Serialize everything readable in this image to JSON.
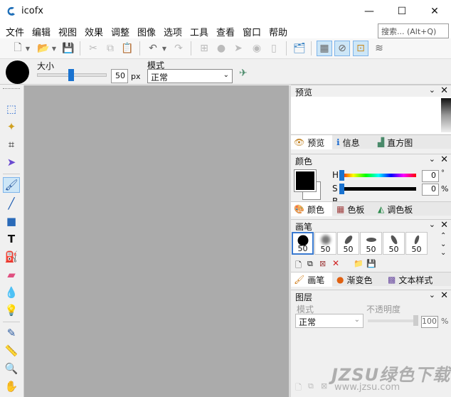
{
  "app": {
    "title": "icofx"
  },
  "window": {
    "minimize": "—",
    "maximize": "☐",
    "close": "✕"
  },
  "menu": [
    "文件",
    "编辑",
    "视图",
    "效果",
    "调整",
    "图像",
    "选项",
    "工具",
    "查看",
    "窗口",
    "帮助"
  ],
  "search": {
    "placeholder": "搜索... (Alt+Q)"
  },
  "options": {
    "size_label": "大小",
    "size_value": "50",
    "size_unit": "px",
    "mode_label": "模式",
    "mode_value": "正常"
  },
  "panels": {
    "preview": {
      "title": "预览",
      "tabs": [
        "预览",
        "信息",
        "直方图"
      ]
    },
    "color": {
      "title": "颜色",
      "h_label": "H",
      "h_value": "0",
      "h_unit": "°",
      "s_label": "S",
      "s_value": "0",
      "s_unit": "%",
      "b_label": "B",
      "tabs": [
        "颜色",
        "色板",
        "调色板"
      ]
    },
    "brush": {
      "title": "画笔",
      "sizes": [
        "50",
        "50",
        "50",
        "50",
        "50",
        "50"
      ],
      "tabs": [
        "画笔",
        "渐变色",
        "文本样式"
      ]
    },
    "layers": {
      "title": "图层",
      "mode_label": "模式",
      "opacity_label": "不透明度",
      "mode_value": "正常",
      "opacity_value": "100",
      "opacity_unit": "%"
    }
  },
  "watermark": {
    "line1": "JZSU绿色下载",
    "line2": "www.jzsu.com"
  },
  "colors": {
    "primary": "#000000",
    "selection": "#cde6f7",
    "canvas": "#ababab"
  }
}
